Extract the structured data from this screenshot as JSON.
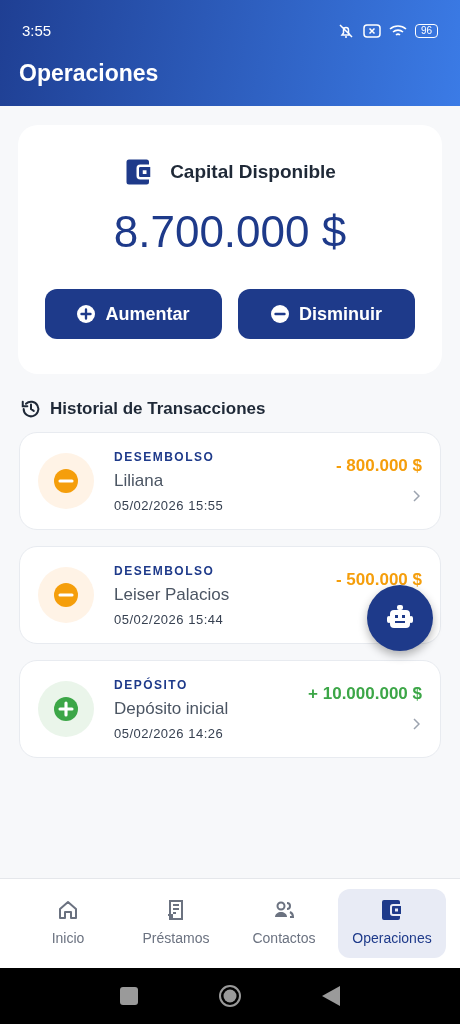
{
  "status_bar": {
    "time": "3:55",
    "battery": "96"
  },
  "header": {
    "title": "Operaciones"
  },
  "capital": {
    "label": "Capital Disponible",
    "amount": "8.700.000 $",
    "buttons": [
      {
        "kind": "plus",
        "label": "Aumentar"
      },
      {
        "kind": "minus",
        "label": "Disminuir"
      }
    ]
  },
  "history": {
    "title": "Historial de Transacciones",
    "items": [
      {
        "kind": "debit",
        "type": "DESEMBOLSO",
        "name": "Liliana",
        "date": "05/02/2026 15:55",
        "amount": "- 800.000 $",
        "chevron": true
      },
      {
        "kind": "debit",
        "type": "DESEMBOLSO",
        "name": "Leiser Palacios",
        "date": "05/02/2026 15:44",
        "amount": "- 500.000 $",
        "chevron": false
      },
      {
        "kind": "credit",
        "type": "DEPÓSITO",
        "name": "Depósito inicial",
        "date": "05/02/2026 14:26",
        "amount": "+ 10.000.000 $",
        "chevron": true
      }
    ]
  },
  "bottom_nav": [
    {
      "label": "Inicio",
      "selected": false
    },
    {
      "label": "Préstamos",
      "selected": false
    },
    {
      "label": "Contactos",
      "selected": false
    },
    {
      "label": "Operaciones",
      "selected": true
    }
  ]
}
